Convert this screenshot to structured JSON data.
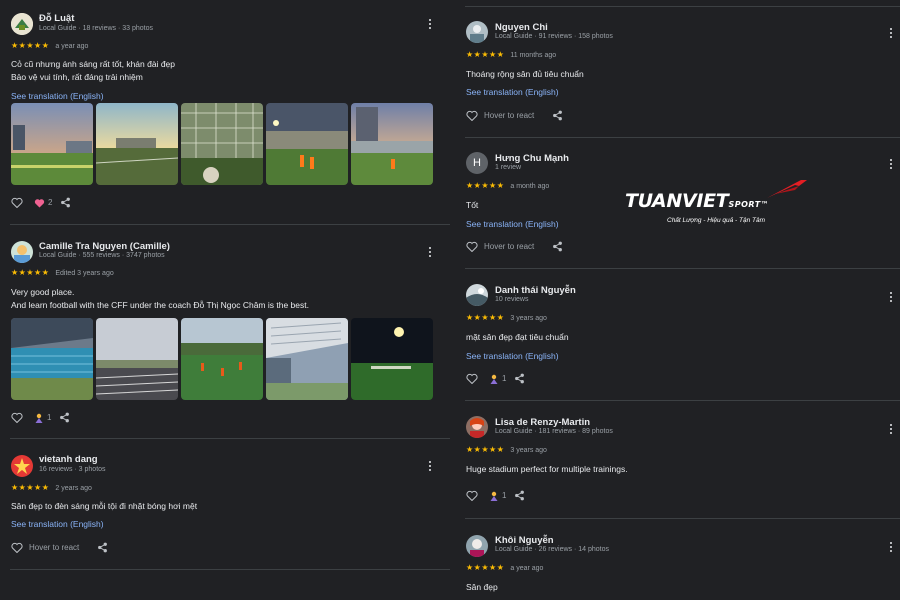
{
  "reviews_left": [
    {
      "name": "Đỗ Luật",
      "meta": "Local Guide · 18 reviews · 33 photos",
      "stars": "★★★★★",
      "ago": "a year ago",
      "text_lines": [
        "Cỏ cũ nhưng ánh sáng rất tốt, khán đài đẹp",
        "Bảo vệ vui tính, rất đáng trải nhiệm"
      ],
      "link": "See translation (English)",
      "react_count": "2"
    },
    {
      "name": "Camille Tra Nguyen (Camille)",
      "meta": "Local Guide · 555 reviews · 3747 photos",
      "stars": "★★★★★",
      "ago": "Edited 3 years ago",
      "text_lines": [
        "Very good place.",
        "And learn football with the CFF under the coach Đỗ Thị Ngọc Châm is the best."
      ],
      "react_count": "1"
    },
    {
      "name": "vietanh dang",
      "meta": "16 reviews · 3 photos",
      "stars": "★★★★★",
      "ago": "2 years ago",
      "text_lines": [
        "Sân đẹp to đèn sáng mỗi tội đi nhặt bóng hơi mệt"
      ],
      "link": "See translation (English)",
      "hover": "Hover to react"
    }
  ],
  "reviews_right": [
    {
      "name": "Nguyen Chi",
      "meta": "Local Guide · 91 reviews · 158 photos",
      "stars": "★★★★★",
      "ago": "11 months ago",
      "text_lines": [
        "Thoáng rộng sân đủ tiêu chuẩn"
      ],
      "link": "See translation (English)",
      "hover": "Hover to react"
    },
    {
      "name": "Hưng Chu Mạnh",
      "avatar_letter": "H",
      "meta": "1 review",
      "stars": "★★★★★",
      "ago": "a month ago",
      "text_lines": [
        "Tốt"
      ],
      "link": "See translation (English)",
      "hover": "Hover to react"
    },
    {
      "name": "Danh thái Nguyễn",
      "meta": "10 reviews",
      "stars": "★★★★★",
      "ago": "3 years ago",
      "text_lines": [
        "mặt sân đẹp đạt tiêu chuẩn"
      ],
      "link": "See translation (English)",
      "react_count": "1"
    },
    {
      "name": "Lisa de Renzy-Martin",
      "meta": "Local Guide · 181 reviews · 89 photos",
      "stars": "★★★★★",
      "ago": "3 years ago",
      "text_lines": [
        "Huge stadium perfect for multiple trainings."
      ],
      "react_count": "1"
    },
    {
      "name": "Khôi Nguyễn",
      "meta": "Local Guide · 26 reviews · 14 photos",
      "stars": "★★★★★",
      "ago": "a year ago",
      "text_lines": [
        "Sân đẹp"
      ]
    }
  ],
  "logo": {
    "main": "TUANVIET",
    "sport": "SPORT",
    "tm": "™",
    "tagline": "Chất Lượng - Hiệu quả - Tận Tâm"
  },
  "colors": {
    "background": "#202124",
    "star": "#fbbc04",
    "link": "#8ab4f8",
    "logo_accent": "#e31e24"
  }
}
